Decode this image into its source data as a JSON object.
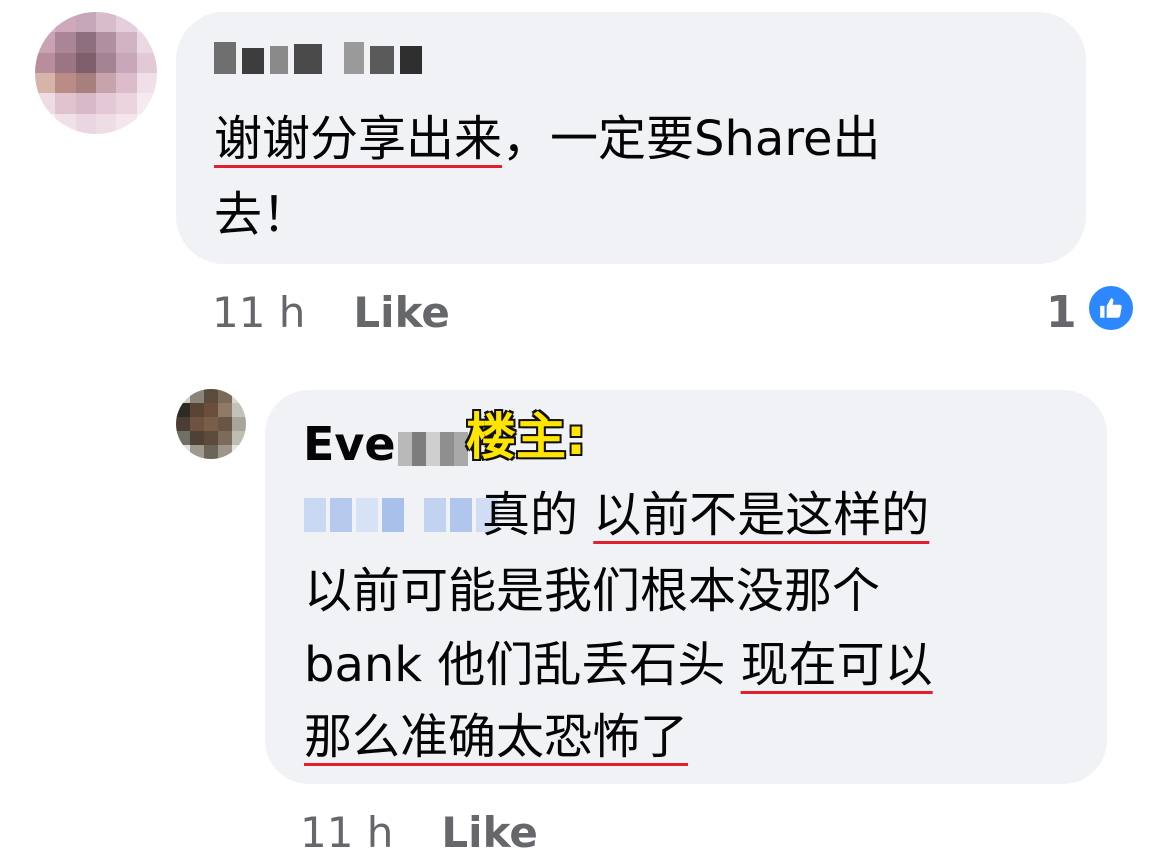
{
  "comments": [
    {
      "text_lines": [
        {
          "segments": [
            {
              "text": "谢谢分享出来",
              "underline": true
            },
            {
              "text": "，一定要Share出",
              "underline": false
            }
          ]
        },
        {
          "segments": [
            {
              "text": "去！",
              "underline": false
            }
          ]
        }
      ],
      "time": "11 h",
      "like_label": "Like",
      "reaction_count": "1",
      "reaction_icon": "thumbs-up-icon"
    },
    {
      "author_visible": "Eve",
      "author_tag": "楼主:",
      "text_lines": [
        {
          "segments": [
            {
              "text": "真的 ",
              "underline": false
            },
            {
              "text": "以前不是这样的",
              "underline": true
            }
          ]
        },
        {
          "segments": [
            {
              "text": "以前可能是我们根本没那个",
              "underline": false
            }
          ]
        },
        {
          "segments": [
            {
              "text": "bank 他们乱丢石头 ",
              "underline": false
            },
            {
              "text": "现在可以",
              "underline": true
            }
          ]
        },
        {
          "segments": [
            {
              "text": "那么准确太恐怖了",
              "underline": true
            }
          ]
        }
      ],
      "time": "11 h",
      "like_label": "Like"
    }
  ],
  "colors": {
    "bubble": "#f0f2f5",
    "meta_text": "#65676b",
    "underline": "#e0202a",
    "like_blue": "#2d88ff",
    "tag_yellow": "#ffe500"
  }
}
